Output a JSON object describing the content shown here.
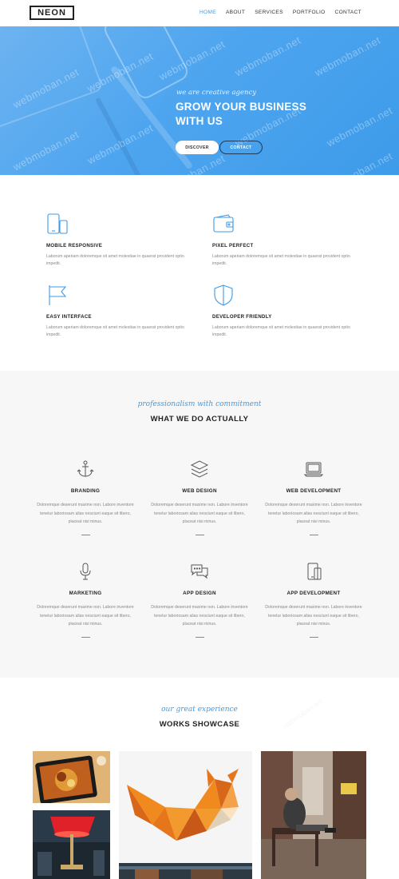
{
  "header": {
    "logo": "NEON",
    "nav": [
      {
        "label": "HOME",
        "active": true
      },
      {
        "label": "ABOUT",
        "active": false
      },
      {
        "label": "SERVICES",
        "active": false
      },
      {
        "label": "PORTFOLIO",
        "active": false
      },
      {
        "label": "CONTACT",
        "active": false
      }
    ]
  },
  "hero": {
    "tagline": "we are creative agency",
    "title_line1": "GROW YOUR BUSINESS",
    "title_line2": "WITH US",
    "discover_label": "DISCOVER",
    "contact_label": "CONTACT",
    "slides": 3,
    "active_slide": 1,
    "watermark": "webmoban.net"
  },
  "features": [
    {
      "icon": "mobile-icon",
      "title": "MOBILE RESPONSIVE",
      "text": "Laborum aperiam doloremque sit amet molestiae in quaerat provident optio impedit."
    },
    {
      "icon": "wallet-icon",
      "title": "PIXEL PERFECT",
      "text": "Laborum aperiam doloremque sit amet molestiae in quaerat provident optio impedit."
    },
    {
      "icon": "flag-icon",
      "title": "EASY INTERFACE",
      "text": "Laborum aperiam doloremque sit amet molestiae in quaerat provident optio impedit."
    },
    {
      "icon": "shield-icon",
      "title": "DEVELOPER FRIENDLY",
      "text": "Laborum aperiam doloremque sit amet molestiae in quaerat provident optio impedit."
    }
  ],
  "services": {
    "script": "professionalism with commitment",
    "title": "WHAT WE DO ACTUALLY",
    "items": [
      {
        "icon": "anchor-icon",
        "title": "BRANDING",
        "text": "Doloremque deserunt maxime non. Labore inventore tenetur laboriosam alias nesciunt eaque sit libero, placeat nisi minus."
      },
      {
        "icon": "layers-icon",
        "title": "WEB DESIGN",
        "text": "Doloremque deserunt maxime non. Labore inventore tenetur laboriosam alias nesciunt eaque sit libero, placeat nisi minus."
      },
      {
        "icon": "laptop-icon",
        "title": "WEB DEVELOPMENT",
        "text": "Doloremque deserunt maxime non. Labore inventore tenetur laboriosam alias nesciunt eaque sit libero, placeat nisi minus."
      },
      {
        "icon": "microphone-icon",
        "title": "MARKETING",
        "text": "Doloremque deserunt maxime non. Labore inventore tenetur laboriosam alias nesciunt eaque sit libero, placeat nisi minus."
      },
      {
        "icon": "chat-bubbles-icon",
        "title": "APP DESIGN",
        "text": "Doloremque deserunt maxime non. Labore inventore tenetur laboriosam alias nesciunt eaque sit libero, placeat nisi minus."
      },
      {
        "icon": "devices-icon",
        "title": "APP DEVELOPMENT",
        "text": "Doloremque deserunt maxime non. Labore inventore tenetur laboriosam alias nesciunt eaque sit libero, placeat nisi minus."
      }
    ]
  },
  "works": {
    "script": "our great experience",
    "title": "WORKS SHOWCASE",
    "items": [
      {
        "name": "tablet-food-photo"
      },
      {
        "name": "red-lamp-photo"
      },
      {
        "name": "origami-fox-photo"
      },
      {
        "name": "street-bench-photo"
      },
      {
        "name": "bottom-strip-photo"
      }
    ]
  },
  "colors": {
    "accent": "#3d9be9",
    "hero_bg": "#4ea5ef",
    "services_bg": "#f7f7f7",
    "text_dark": "#222222",
    "text_muted": "#888888"
  }
}
